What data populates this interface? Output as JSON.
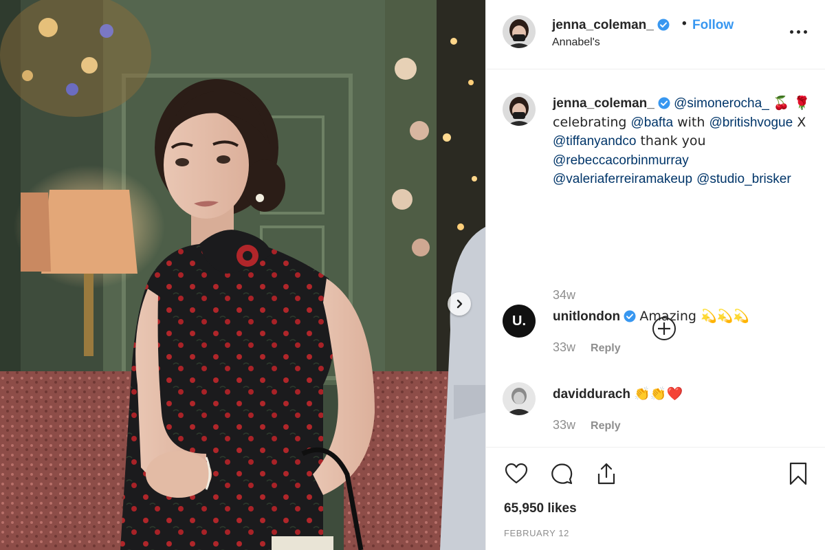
{
  "post": {
    "author": {
      "username": "jenna_coleman_",
      "verified": true,
      "location": "Annabel's",
      "follow_label": "Follow",
      "separator": "•"
    },
    "caption": {
      "username": "jenna_coleman_",
      "segments": [
        {
          "type": "mention",
          "text": "@simonerocha_"
        },
        {
          "type": "text",
          "text": " 🍒 🌹celebrating "
        },
        {
          "type": "mention",
          "text": "@bafta"
        },
        {
          "type": "text",
          "text": " with "
        },
        {
          "type": "mention",
          "text": "@britishvogue"
        },
        {
          "type": "text",
          "text": " X "
        },
        {
          "type": "mention",
          "text": "@tiffanyandco"
        },
        {
          "type": "text",
          "text": " thank you "
        },
        {
          "type": "mention",
          "text": "@rebeccacorbinmurray"
        },
        {
          "type": "text",
          "text": " "
        },
        {
          "type": "mention",
          "text": "@valeriaferreiramakeup"
        },
        {
          "type": "text",
          "text": " "
        },
        {
          "type": "mention",
          "text": "@studio_brisker"
        }
      ],
      "time": "34w"
    },
    "load_more_icon": "plus-circle-icon",
    "comments": [
      {
        "username": "unitlondon",
        "verified": true,
        "text": "Amazing 💫💫💫",
        "time": "33w",
        "reply_label": "Reply",
        "avatar_text": "U."
      },
      {
        "username": "daviddurach",
        "verified": false,
        "text": "👏👏❤️",
        "time": "33w",
        "reply_label": "Reply",
        "avatar_text": ""
      }
    ],
    "actions": {
      "like_icon": "heart-icon",
      "comment_icon": "comment-icon",
      "share_icon": "share-icon",
      "save_icon": "bookmark-icon"
    },
    "likes": "65,950 likes",
    "date": "FEBRUARY 12"
  },
  "colors": {
    "link": "#3897f0",
    "mention": "#003569",
    "verified": "#3897f0",
    "muted": "#8e8e8e",
    "text": "#262626"
  }
}
